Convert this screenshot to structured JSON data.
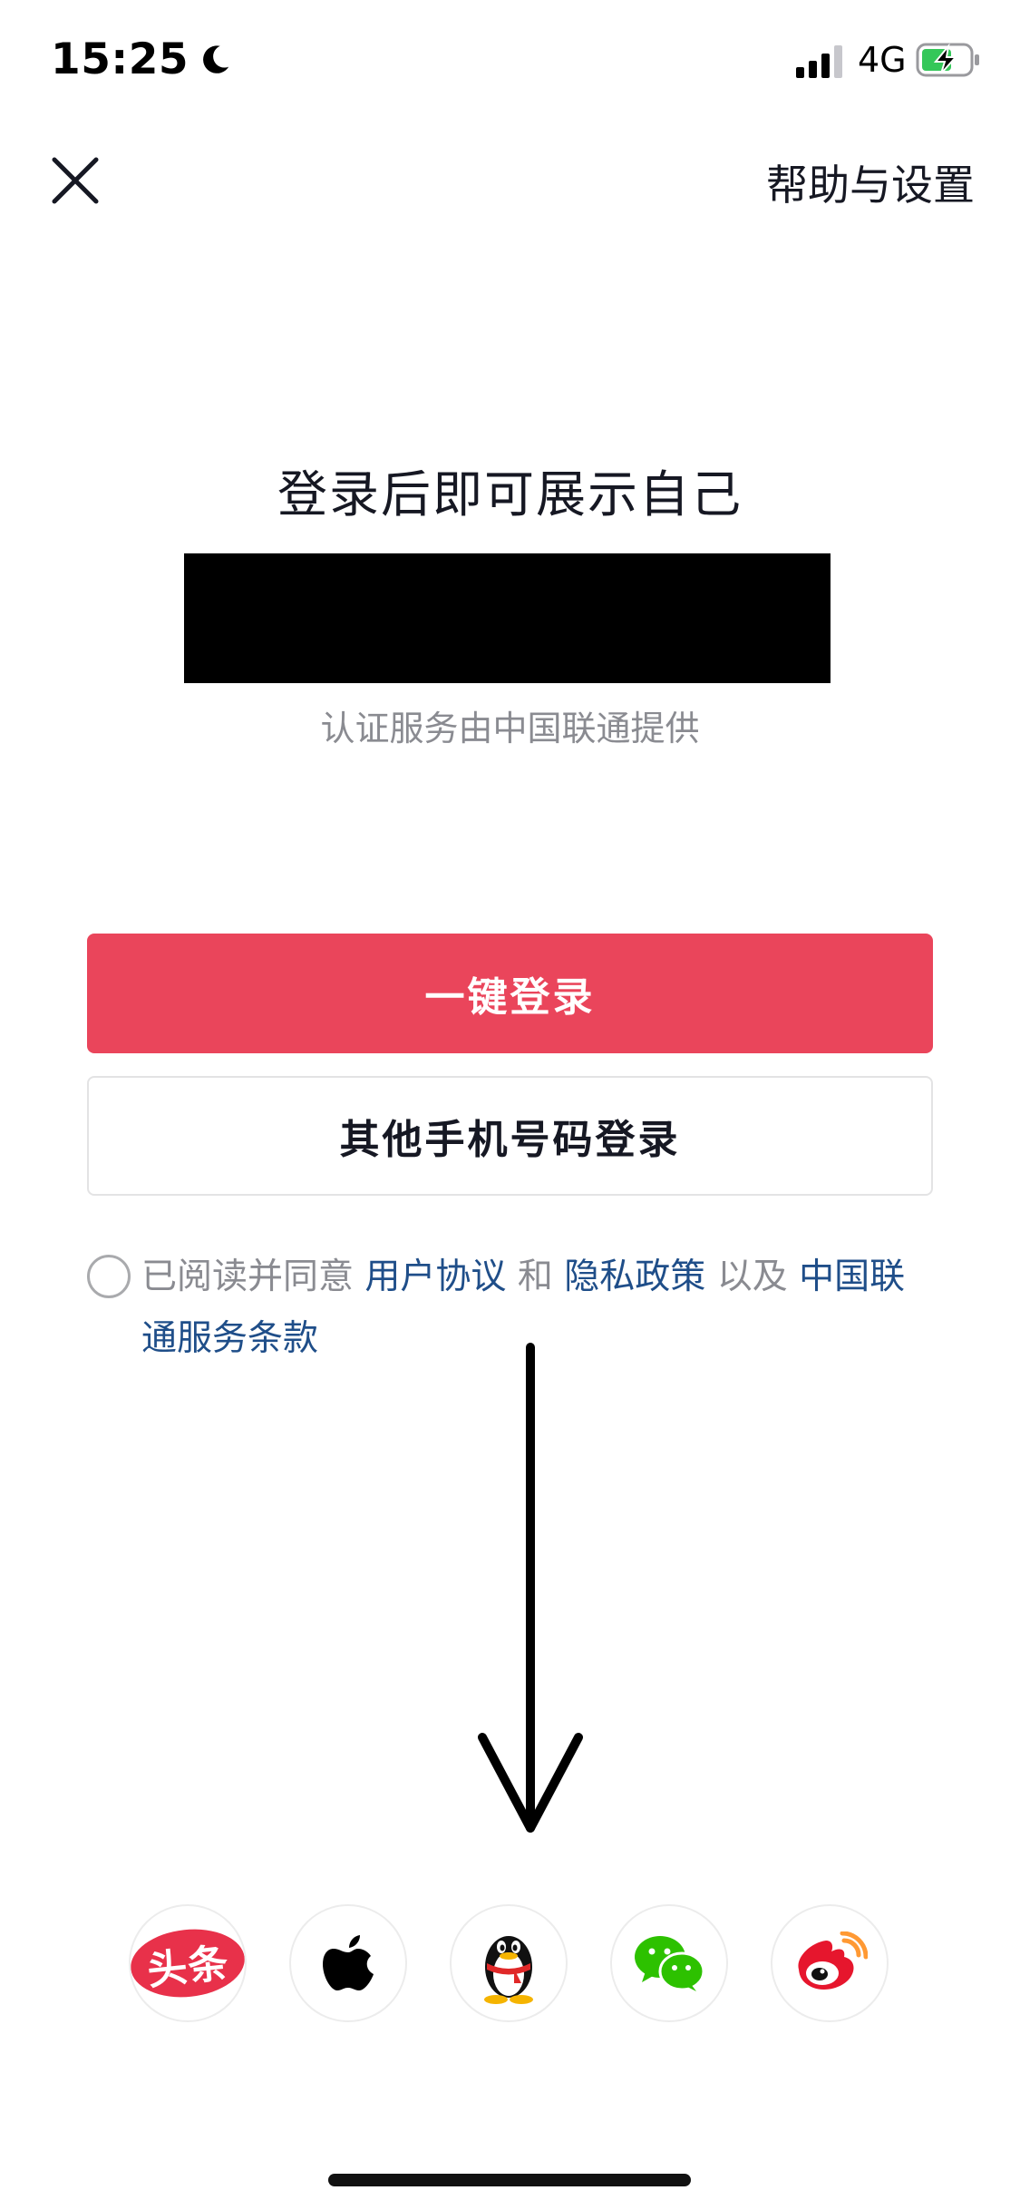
{
  "status_bar": {
    "time": "15:25",
    "moon_icon": "moon-icon",
    "signal_icon": "cellular-signal-icon",
    "network": "4G",
    "battery_icon": "battery-charging-icon",
    "battery_color": "#34c759"
  },
  "header": {
    "close_icon": "close-icon",
    "help_label": "帮助与设置"
  },
  "main": {
    "title": "登录后即可展示自己",
    "provider_note": "认证服务由中国联通提供"
  },
  "buttons": {
    "one_click_label": "一键登录",
    "other_phone_label": "其他手机号码登录",
    "primary_color": "#ea455b"
  },
  "agreement": {
    "prefix": "已阅读并同意",
    "user_agreement": "用户协议",
    "and": "和",
    "privacy_policy": "隐私政策",
    "as_well_as": "以及",
    "unicom_terms": "中国联通服务条款",
    "link_color": "#1f4e89"
  },
  "social_login": {
    "items": [
      {
        "icon": "toutiao-icon",
        "label": "头条"
      },
      {
        "icon": "apple-icon"
      },
      {
        "icon": "qq-icon"
      },
      {
        "icon": "wechat-icon"
      },
      {
        "icon": "weibo-icon"
      }
    ]
  }
}
